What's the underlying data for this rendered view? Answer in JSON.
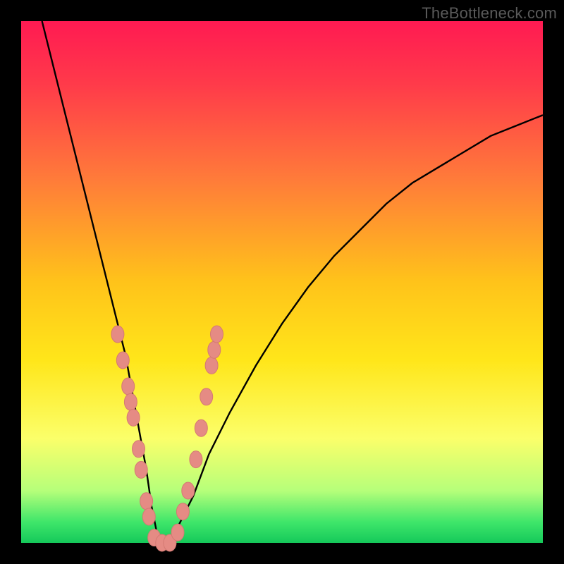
{
  "watermark": {
    "text": "TheBottleneck.com"
  },
  "colors": {
    "frame": "#000000",
    "curve_stroke": "#000000",
    "marker_fill": "#e58b84",
    "marker_stroke": "#d47a73",
    "gradient_stops": [
      {
        "pct": 0,
        "color": "#ff1a52"
      },
      {
        "pct": 12,
        "color": "#ff3a4a"
      },
      {
        "pct": 30,
        "color": "#ff7a3a"
      },
      {
        "pct": 50,
        "color": "#ffc31a"
      },
      {
        "pct": 65,
        "color": "#ffe61a"
      },
      {
        "pct": 80,
        "color": "#fbff6a"
      },
      {
        "pct": 90,
        "color": "#b6ff7a"
      },
      {
        "pct": 96,
        "color": "#3fe66a"
      },
      {
        "pct": 100,
        "color": "#15c95a"
      }
    ]
  },
  "chart_data": {
    "type": "line",
    "title": "",
    "xlabel": "",
    "ylabel": "",
    "xlim": [
      0,
      100
    ],
    "ylim": [
      0,
      100
    ],
    "grid": false,
    "legend": false,
    "notes": "V-shaped bottleneck curve over a red-to-green vertical heat gradient. The curve minimum is the zero-bottleneck point.",
    "series": [
      {
        "name": "bottleneck-curve",
        "x": [
          4,
          6,
          8,
          10,
          12,
          14,
          16,
          18,
          20,
          22,
          24,
          25,
          26,
          27,
          28,
          30,
          33,
          36,
          40,
          45,
          50,
          55,
          60,
          65,
          70,
          75,
          80,
          85,
          90,
          95,
          100
        ],
        "y": [
          100,
          92,
          84,
          76,
          68,
          60,
          52,
          44,
          36,
          25,
          14,
          7,
          2,
          0,
          0,
          3,
          9,
          17,
          25,
          34,
          42,
          49,
          55,
          60,
          65,
          69,
          72,
          75,
          78,
          80,
          82
        ]
      }
    ],
    "markers": {
      "name": "highlighted-points",
      "points": [
        {
          "x": 18.5,
          "y": 40
        },
        {
          "x": 19.5,
          "y": 35
        },
        {
          "x": 20.5,
          "y": 30
        },
        {
          "x": 21.0,
          "y": 27
        },
        {
          "x": 21.5,
          "y": 24
        },
        {
          "x": 22.5,
          "y": 18
        },
        {
          "x": 23.0,
          "y": 14
        },
        {
          "x": 24.0,
          "y": 8
        },
        {
          "x": 24.5,
          "y": 5
        },
        {
          "x": 25.5,
          "y": 1
        },
        {
          "x": 27.0,
          "y": 0
        },
        {
          "x": 28.5,
          "y": 0
        },
        {
          "x": 30.0,
          "y": 2
        },
        {
          "x": 31.0,
          "y": 6
        },
        {
          "x": 32.0,
          "y": 10
        },
        {
          "x": 33.5,
          "y": 16
        },
        {
          "x": 34.5,
          "y": 22
        },
        {
          "x": 35.5,
          "y": 28
        },
        {
          "x": 36.5,
          "y": 34
        },
        {
          "x": 37.0,
          "y": 37
        },
        {
          "x": 37.5,
          "y": 40
        }
      ]
    }
  }
}
